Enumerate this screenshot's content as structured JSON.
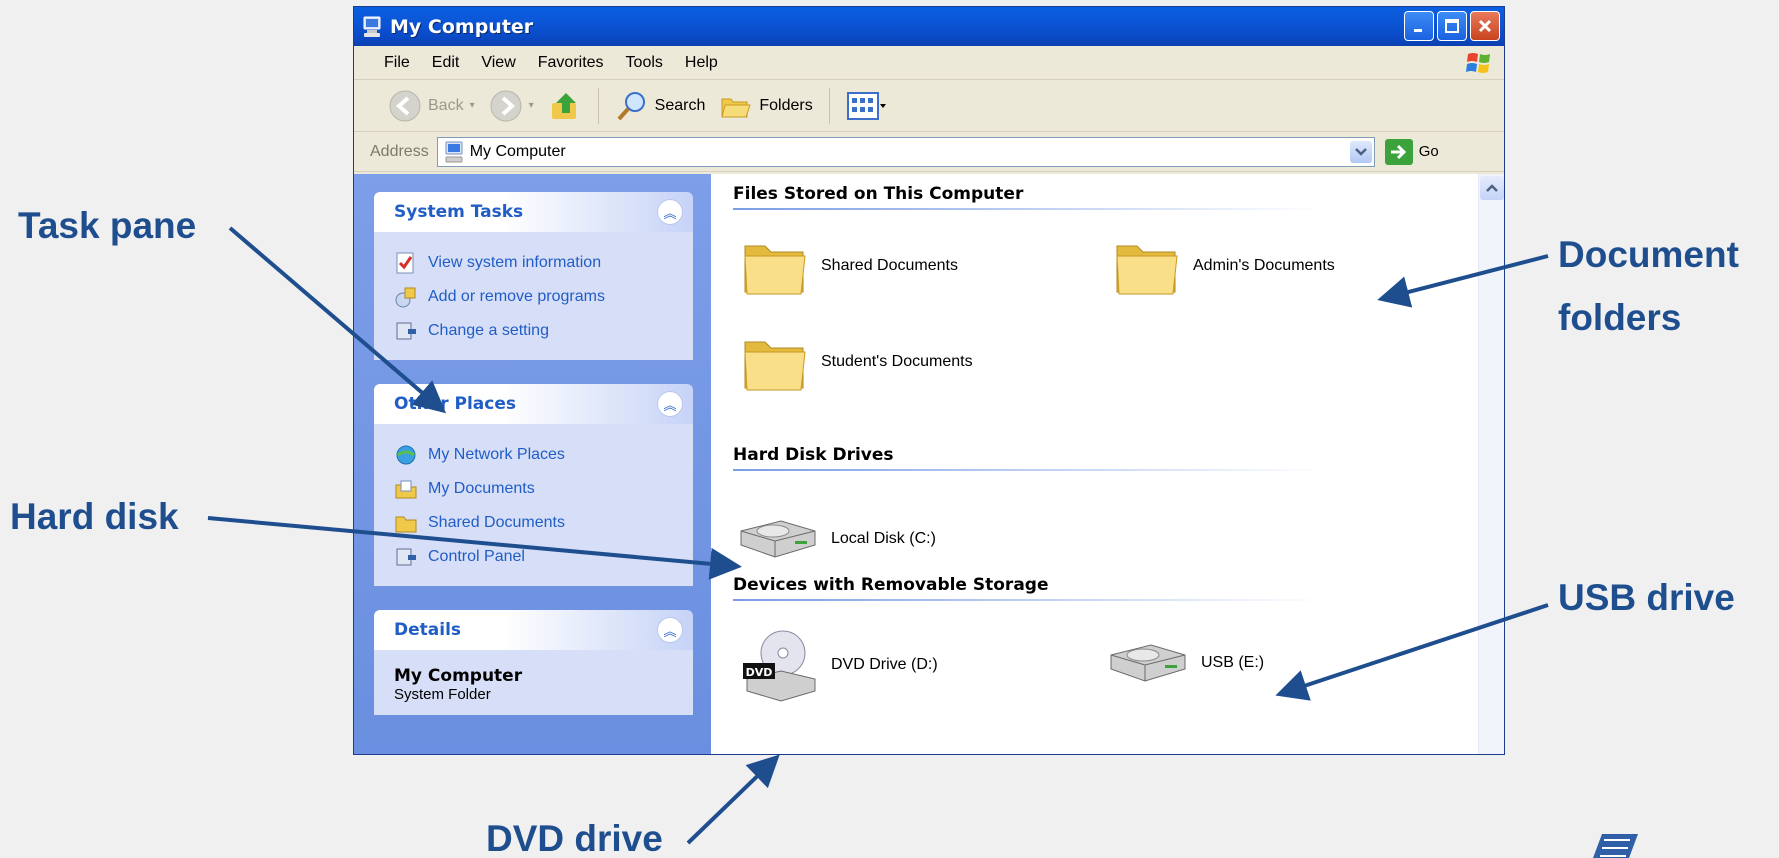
{
  "window": {
    "title": "My Computer"
  },
  "menu": [
    "File",
    "Edit",
    "View",
    "Favorites",
    "Tools",
    "Help"
  ],
  "toolbar": {
    "back": "Back",
    "search": "Search",
    "folders": "Folders"
  },
  "address": {
    "label": "Address",
    "value": "My Computer",
    "go": "Go"
  },
  "taskpane": {
    "system_tasks": {
      "title": "System Tasks",
      "items": [
        "View system information",
        "Add or remove programs",
        "Change a setting"
      ]
    },
    "other_places": {
      "title": "Other Places",
      "items": [
        "My Network Places",
        "My Documents",
        "Shared Documents",
        "Control Panel"
      ]
    },
    "details": {
      "title": "Details",
      "name": "My Computer",
      "type": "System Folder"
    }
  },
  "main": {
    "files_group": "Files Stored on This Computer",
    "folders": [
      "Shared Documents",
      "Admin's Documents",
      "Student's Documents"
    ],
    "hdd_group": "Hard Disk Drives",
    "local_disk": "Local Disk (C:)",
    "removable_group": "Devices with Removable Storage",
    "dvd": "DVD Drive (D:)",
    "dvd_badge": "DVD",
    "usb": "USB (E:)"
  },
  "callouts": {
    "task_pane": "Task pane",
    "document_folders_line1": "Document",
    "document_folders_line2": "folders",
    "hard_disk": "Hard disk",
    "usb_drive": "USB drive",
    "dvd_drive": "DVD drive"
  },
  "colors": {
    "callout": "#1f4e8f",
    "titlebar": "#0a55d6",
    "taskpane": "#7d9ee8",
    "link": "#215dc6"
  }
}
